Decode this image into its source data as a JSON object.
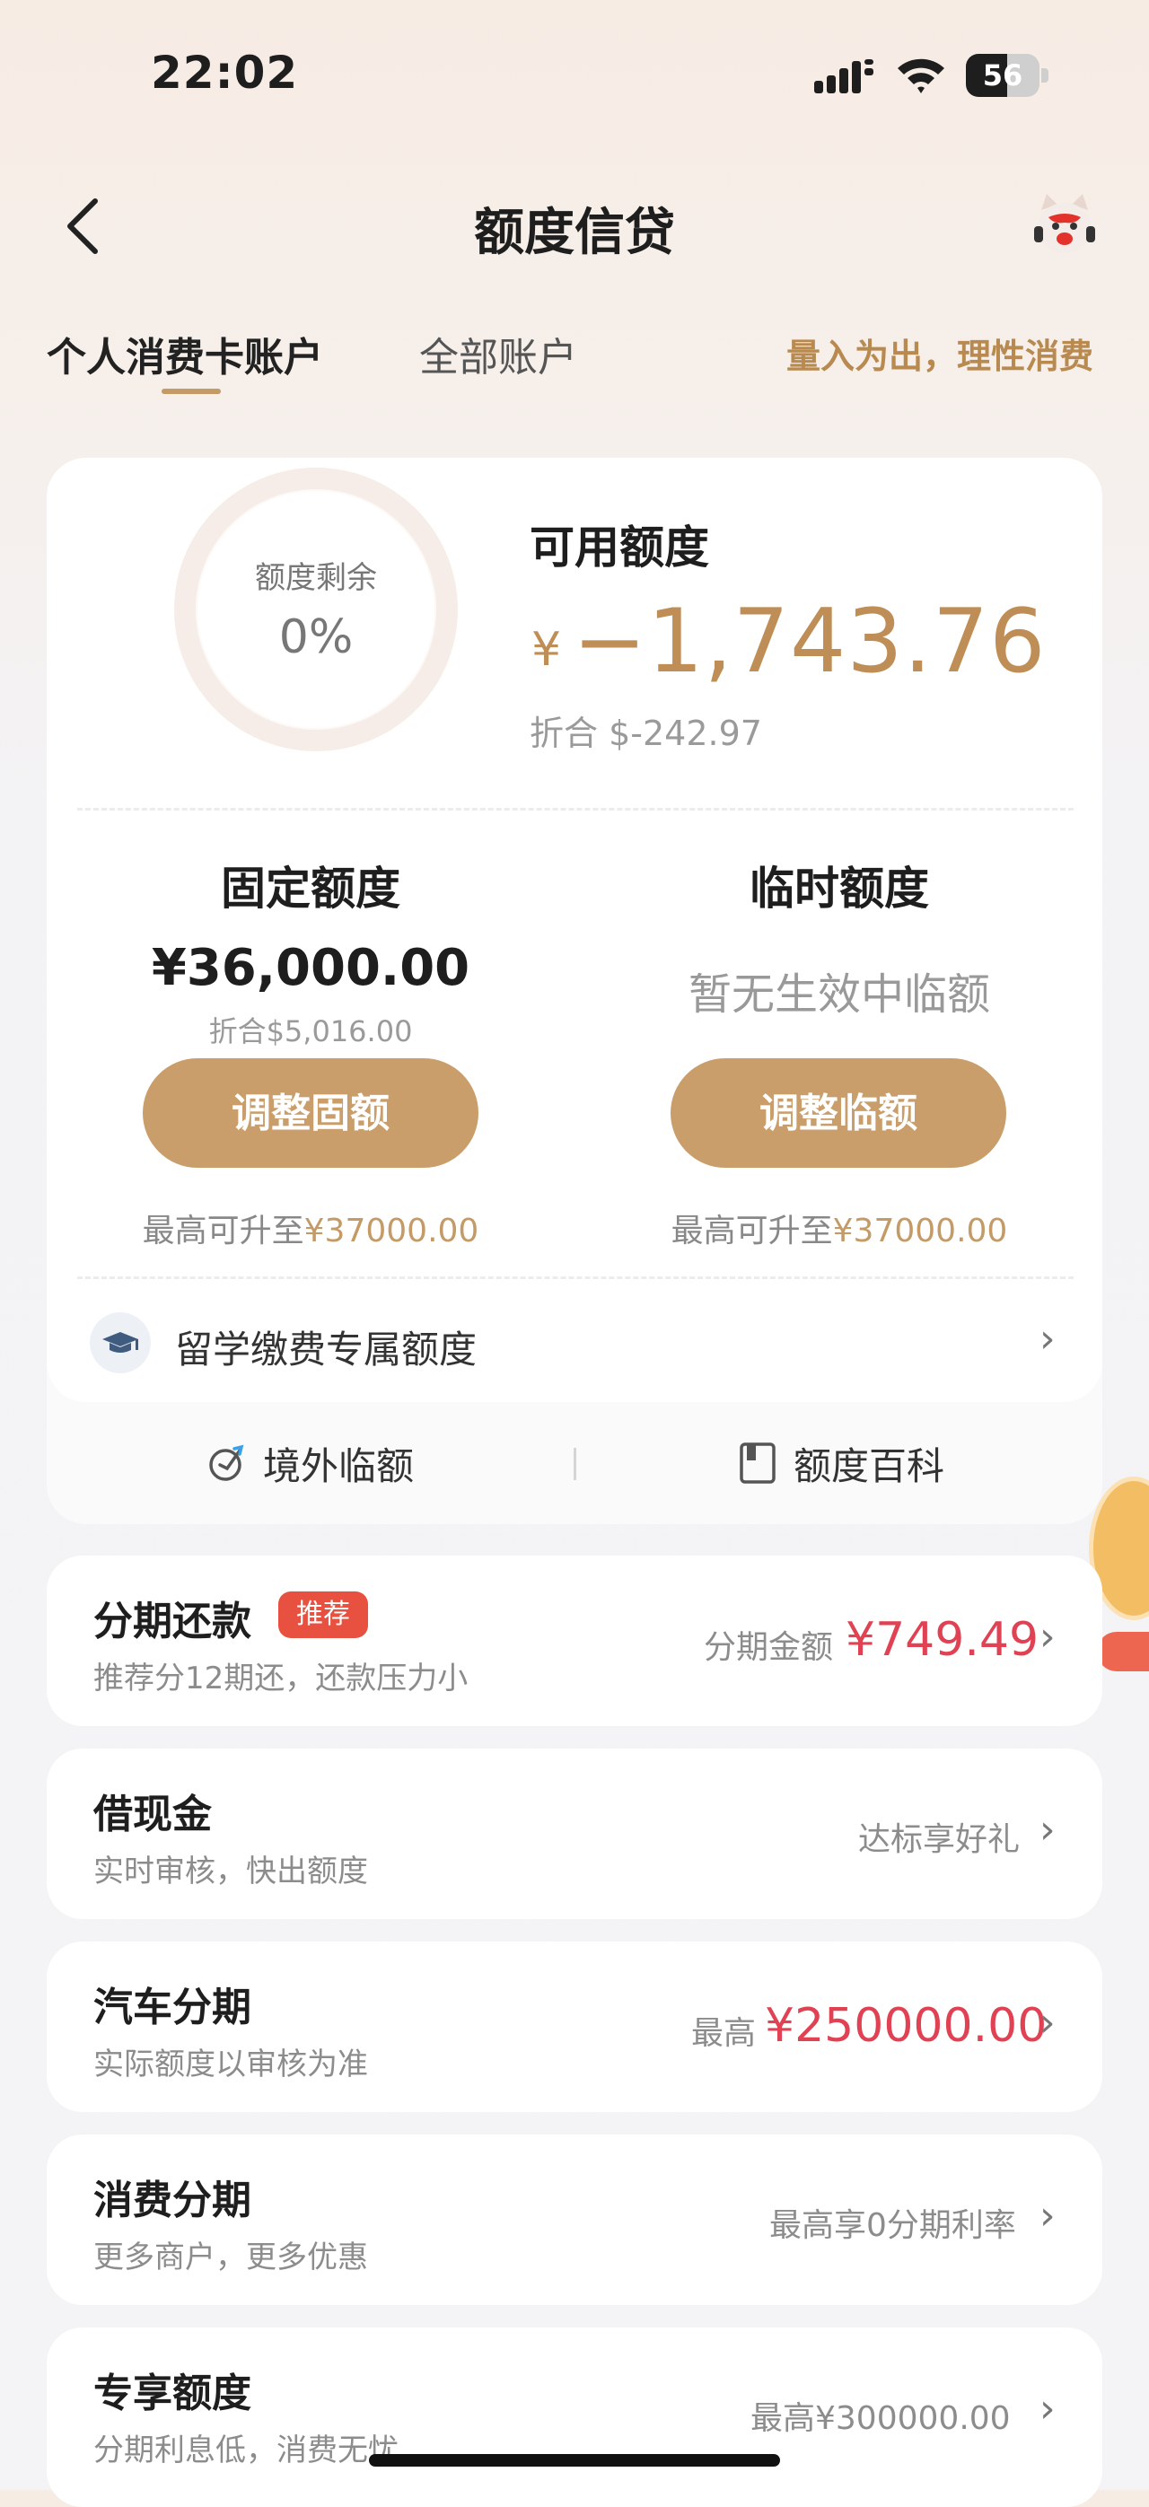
{
  "status_bar": {
    "time": "22:02",
    "battery": "56",
    "battery_level": 0.56
  },
  "nav": {
    "title": "额度信贷"
  },
  "tabs": {
    "items": [
      {
        "label": "个人消费卡账户",
        "active": true
      },
      {
        "label": "全部账户",
        "active": false
      }
    ],
    "slogan": "量入为出，理性消费"
  },
  "summary": {
    "ring_label": "额度剩余",
    "ring_percent": "0%",
    "ring_fraction": 0,
    "available_label": "可用额度",
    "currency": "¥",
    "available_amount": "−1,743.76",
    "usd_equivalent": "折合 $-242.97"
  },
  "fixed": {
    "title": "固定额度",
    "amount": "¥36,000.00",
    "usd": "折合$5,016.00",
    "button": "调整固额",
    "max_prefix": "最高可升至",
    "max_value": "¥37000.00"
  },
  "temporary": {
    "title": "临时额度",
    "status": "暂无生效中临额",
    "button": "调整临额",
    "max_prefix": "最高可升至",
    "max_value": "¥37000.00"
  },
  "study": {
    "label": "留学缴费专属额度"
  },
  "links": {
    "overseas": "境外临额",
    "wiki": "额度百科"
  },
  "list": [
    {
      "title": "分期还款",
      "badge": "推荐",
      "subtitle": "推荐分12期还，还款压力小",
      "right_label": "分期金额",
      "right_value": "¥749.49"
    },
    {
      "title": "借现金",
      "subtitle": "实时审核，快出额度",
      "right_label": "达标享好礼"
    },
    {
      "title": "汽车分期",
      "subtitle": "实际额度以审核为准",
      "right_label": "最高",
      "right_value": "¥250000.00"
    },
    {
      "title": "消费分期",
      "subtitle": "更多商户，更多优惠",
      "right_label": "最高享0分期利率"
    },
    {
      "title": "专享额度",
      "subtitle": "分期利息低，消费无忧",
      "right_label": "最高¥300000.00"
    }
  ],
  "colors": {
    "accent": "#c99e6b",
    "accent_text": "#bf8e56",
    "red": "#e04153",
    "badge": "#e8503f"
  },
  "icons": [
    "back-arrow-icon",
    "mascot-icon",
    "graduation-cap-icon",
    "globe-plane-icon",
    "book-icon",
    "chevron-right-icon"
  ]
}
